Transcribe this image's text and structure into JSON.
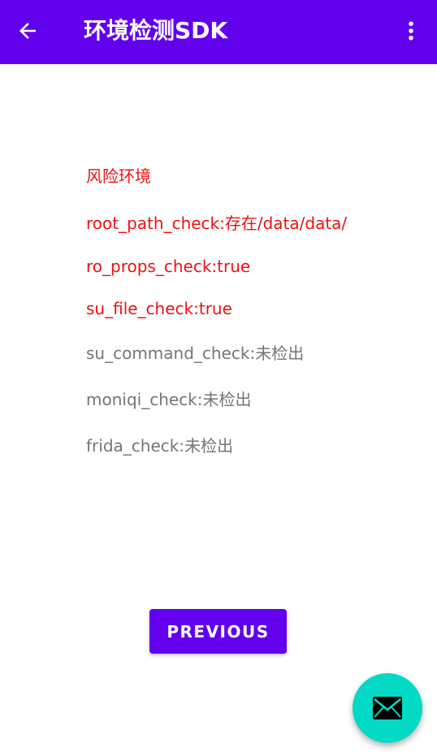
{
  "toolbar": {
    "title": "环境检测SDK",
    "back_icon": "arrow-back-icon",
    "menu_icon": "more-vert-icon",
    "color": "#6200EE"
  },
  "results": {
    "heading": "风险环境",
    "lines": [
      {
        "text": "root_path_check:存在/data/data/",
        "status": "risk"
      },
      {
        "text": "ro_props_check:true",
        "status": "risk"
      },
      {
        "text": "su_file_check:true",
        "status": "risk"
      },
      {
        "text": "su_command_check:未检出",
        "status": "safe"
      },
      {
        "text": "moniqi_check:未检出",
        "status": "safe"
      },
      {
        "text": "frida_check:未检出",
        "status": "safe"
      }
    ],
    "risk_color": "#EE1111",
    "safe_color": "#757575"
  },
  "previous_button": {
    "label": "PREVIOUS"
  },
  "fab": {
    "icon": "email-icon",
    "color": "#03DAC5"
  }
}
